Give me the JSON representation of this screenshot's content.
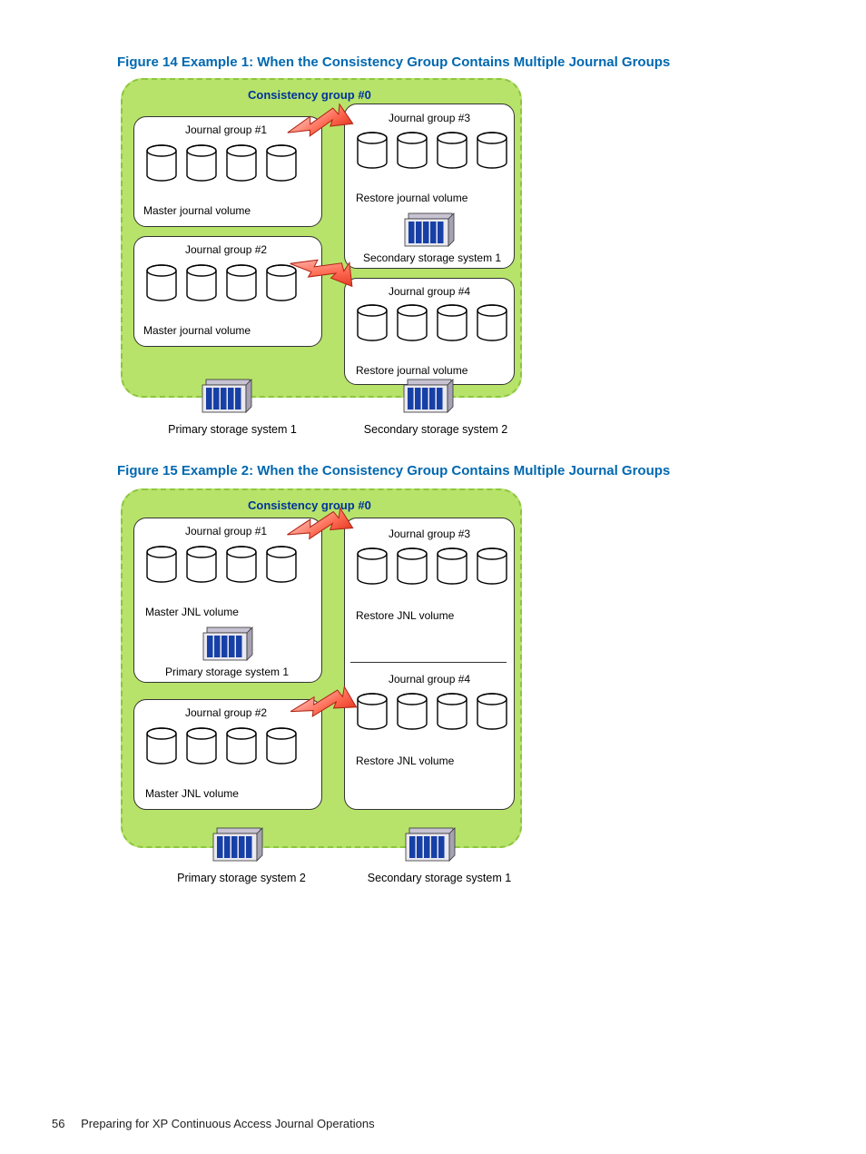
{
  "figure14_caption": "Figure 14 Example 1: When the Consistency Group Contains Multiple Journal Groups",
  "figure15_caption": "Figure 15 Example 2: When the Consistency Group Contains Multiple Journal Groups",
  "footer_page": "56",
  "footer_text": "Preparing for XP Continuous Access Journal Operations",
  "fig14": {
    "cg_title": "Consistency group  #0",
    "jg1_title": "Journal group  #1",
    "jg1_vol": "Master journal volume",
    "jg2_title": "Journal group  #2",
    "jg2_vol": "Master journal volume",
    "jg3_title": "Journal group  #3",
    "jg3_vol": "Restore journal volume",
    "jg4_title": "Journal group  #4",
    "jg4_vol": "Restore journal volume",
    "sec1": "Secondary storage system 1",
    "primary_sys": "Primary storage system 1",
    "secondary_sys": "Secondary storage system 2"
  },
  "fig15": {
    "cg_title": "Consistency group  #0",
    "jg1_title": "Journal group  #1",
    "jg1_vol": "Master JNL volume",
    "jg2_title": "Journal group  #2",
    "jg2_vol": "Master JNL volume",
    "jg3_title": "Journal group  #3",
    "jg3_vol": "Restore JNL volume",
    "jg4_title": "Journal group  #4",
    "jg4_vol": "Restore JNL volume",
    "prim1": "Primary storage system 1",
    "prim2": "Primary storage system 2",
    "sec1": "Secondary storage system 1"
  }
}
